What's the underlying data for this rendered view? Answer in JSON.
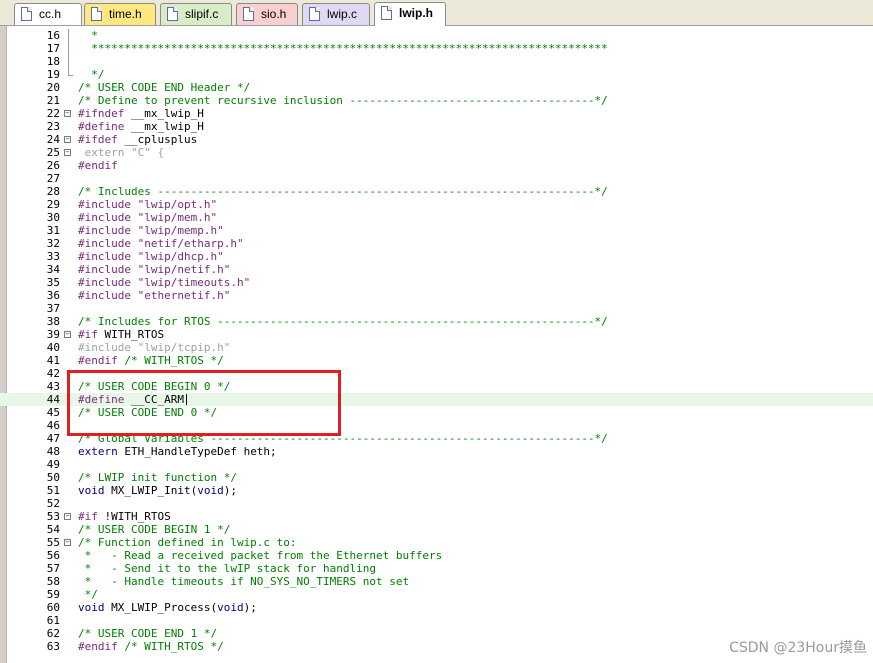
{
  "tabs": [
    {
      "label": "cc.h",
      "color": "#ffffff",
      "active": false
    },
    {
      "label": "time.h",
      "color": "#ffe880",
      "active": false
    },
    {
      "label": "slipif.c",
      "color": "#d8ecc8",
      "active": false
    },
    {
      "label": "sio.h",
      "color": "#f8d0d0",
      "active": false
    },
    {
      "label": "lwip.c",
      "color": "#e0d8f4",
      "active": false
    },
    {
      "label": "lwip.h",
      "color": "#ffffff",
      "active": true
    }
  ],
  "lines": [
    {
      "n": "16",
      "parts": [
        {
          "t": "  *",
          "c": "comment"
        }
      ]
    },
    {
      "n": "17",
      "parts": [
        {
          "t": "  ******************************************************************************",
          "c": "comment"
        }
      ]
    },
    {
      "n": "18",
      "parts": []
    },
    {
      "n": "19",
      "parts": [
        {
          "t": "  */",
          "c": "comment"
        }
      ]
    },
    {
      "n": "20",
      "parts": [
        {
          "t": "/* USER CODE END Header */",
          "c": "comment"
        }
      ]
    },
    {
      "n": "21",
      "parts": [
        {
          "t": "/* Define to prevent recursive inclusion -------------------------------------*/",
          "c": "comment"
        }
      ]
    },
    {
      "n": "22",
      "parts": [
        {
          "t": "#ifndef ",
          "c": "pre"
        },
        {
          "t": "__mx_lwip_H",
          "c": "plain"
        }
      ]
    },
    {
      "n": "23",
      "parts": [
        {
          "t": "#define ",
          "c": "pre"
        },
        {
          "t": "__mx_lwip_H",
          "c": "plain"
        }
      ]
    },
    {
      "n": "24",
      "parts": [
        {
          "t": "#ifdef ",
          "c": "pre"
        },
        {
          "t": "__cplusplus",
          "c": "plain"
        }
      ]
    },
    {
      "n": "25",
      "parts": [
        {
          "t": " extern ",
          "c": "pre-dis"
        },
        {
          "t": "\"C\"",
          "c": "str-dis"
        },
        {
          "t": " {",
          "c": "pre-dis"
        }
      ]
    },
    {
      "n": "26",
      "parts": [
        {
          "t": "#endif",
          "c": "pre"
        }
      ]
    },
    {
      "n": "27",
      "parts": []
    },
    {
      "n": "28",
      "parts": [
        {
          "t": "/* Includes ------------------------------------------------------------------*/",
          "c": "comment"
        }
      ]
    },
    {
      "n": "29",
      "parts": [
        {
          "t": "#include ",
          "c": "pre"
        },
        {
          "t": "\"lwip/opt.h\"",
          "c": "str"
        }
      ]
    },
    {
      "n": "30",
      "parts": [
        {
          "t": "#include ",
          "c": "pre"
        },
        {
          "t": "\"lwip/mem.h\"",
          "c": "str"
        }
      ]
    },
    {
      "n": "31",
      "parts": [
        {
          "t": "#include ",
          "c": "pre"
        },
        {
          "t": "\"lwip/memp.h\"",
          "c": "str"
        }
      ]
    },
    {
      "n": "32",
      "parts": [
        {
          "t": "#include ",
          "c": "pre"
        },
        {
          "t": "\"netif/etharp.h\"",
          "c": "str"
        }
      ]
    },
    {
      "n": "33",
      "parts": [
        {
          "t": "#include ",
          "c": "pre"
        },
        {
          "t": "\"lwip/dhcp.h\"",
          "c": "str"
        }
      ]
    },
    {
      "n": "34",
      "parts": [
        {
          "t": "#include ",
          "c": "pre"
        },
        {
          "t": "\"lwip/netif.h\"",
          "c": "str"
        }
      ]
    },
    {
      "n": "35",
      "parts": [
        {
          "t": "#include ",
          "c": "pre"
        },
        {
          "t": "\"lwip/timeouts.h\"",
          "c": "str"
        }
      ]
    },
    {
      "n": "36",
      "parts": [
        {
          "t": "#include ",
          "c": "pre"
        },
        {
          "t": "\"ethernetif.h\"",
          "c": "str"
        }
      ]
    },
    {
      "n": "37",
      "parts": []
    },
    {
      "n": "38",
      "parts": [
        {
          "t": "/* Includes for RTOS ---------------------------------------------------------*/",
          "c": "comment"
        }
      ]
    },
    {
      "n": "39",
      "parts": [
        {
          "t": "#if ",
          "c": "pre"
        },
        {
          "t": "WITH_RTOS",
          "c": "plain"
        }
      ]
    },
    {
      "n": "40",
      "parts": [
        {
          "t": "#include ",
          "c": "pre-dis"
        },
        {
          "t": "\"lwip/tcpip.h\"",
          "c": "str-dis"
        }
      ]
    },
    {
      "n": "41",
      "parts": [
        {
          "t": "#endif ",
          "c": "pre"
        },
        {
          "t": "/* WITH_RTOS */",
          "c": "comment"
        }
      ]
    },
    {
      "n": "42",
      "parts": []
    },
    {
      "n": "43",
      "parts": [
        {
          "t": "/* USER CODE BEGIN 0 */",
          "c": "comment"
        }
      ]
    },
    {
      "n": "44",
      "parts": [
        {
          "t": "#define ",
          "c": "pre"
        },
        {
          "t": "__CC_ARM",
          "c": "plain"
        }
      ],
      "current": true
    },
    {
      "n": "45",
      "parts": [
        {
          "t": "/* USER CODE END 0 */",
          "c": "comment"
        }
      ]
    },
    {
      "n": "46",
      "parts": []
    },
    {
      "n": "47",
      "parts": [
        {
          "t": "/* Global Variables ----------------------------------------------------------*/",
          "c": "comment"
        }
      ]
    },
    {
      "n": "48",
      "parts": [
        {
          "t": "extern ",
          "c": "kw"
        },
        {
          "t": "ETH_HandleTypeDef heth;",
          "c": "plain"
        }
      ]
    },
    {
      "n": "49",
      "parts": []
    },
    {
      "n": "50",
      "parts": [
        {
          "t": "/* LWIP init function */",
          "c": "comment"
        }
      ]
    },
    {
      "n": "51",
      "parts": [
        {
          "t": "void ",
          "c": "kw"
        },
        {
          "t": "MX_LWIP_Init(",
          "c": "plain"
        },
        {
          "t": "void",
          "c": "kw"
        },
        {
          "t": ");",
          "c": "plain"
        }
      ]
    },
    {
      "n": "52",
      "parts": []
    },
    {
      "n": "53",
      "parts": [
        {
          "t": "#if ",
          "c": "pre"
        },
        {
          "t": "!WITH_RTOS",
          "c": "plain"
        }
      ]
    },
    {
      "n": "54",
      "parts": [
        {
          "t": "/* USER CODE BEGIN 1 */",
          "c": "comment"
        }
      ]
    },
    {
      "n": "55",
      "parts": [
        {
          "t": "/* Function defined in lwip.c to:",
          "c": "comment"
        }
      ]
    },
    {
      "n": "56",
      "parts": [
        {
          "t": " *   - Read a received packet from the Ethernet buffers",
          "c": "comment"
        }
      ]
    },
    {
      "n": "57",
      "parts": [
        {
          "t": " *   - Send it to the lwIP stack for handling",
          "c": "comment"
        }
      ]
    },
    {
      "n": "58",
      "parts": [
        {
          "t": " *   - Handle timeouts if NO_SYS_NO_TIMERS not set",
          "c": "comment"
        }
      ]
    },
    {
      "n": "59",
      "parts": [
        {
          "t": " */",
          "c": "comment"
        }
      ]
    },
    {
      "n": "60",
      "parts": [
        {
          "t": "void ",
          "c": "kw"
        },
        {
          "t": "MX_LWIP_Process(",
          "c": "plain"
        },
        {
          "t": "void",
          "c": "kw"
        },
        {
          "t": ");",
          "c": "plain"
        }
      ]
    },
    {
      "n": "61",
      "parts": []
    },
    {
      "n": "62",
      "parts": [
        {
          "t": "/* USER CODE END 1 */",
          "c": "comment"
        }
      ]
    },
    {
      "n": "63",
      "parts": [
        {
          "t": "#endif ",
          "c": "pre"
        },
        {
          "t": "/* WITH_RTOS */",
          "c": "comment"
        }
      ]
    }
  ],
  "folds": [
    {
      "type": "line",
      "from": 16,
      "to": 19
    },
    {
      "type": "box",
      "at": 22
    },
    {
      "type": "box",
      "at": 24
    },
    {
      "type": "box",
      "at": 25
    },
    {
      "type": "box",
      "at": 39
    },
    {
      "type": "box",
      "at": 53
    },
    {
      "type": "box",
      "at": 55
    }
  ],
  "watermark": "CSDN @23Hour摸鱼"
}
